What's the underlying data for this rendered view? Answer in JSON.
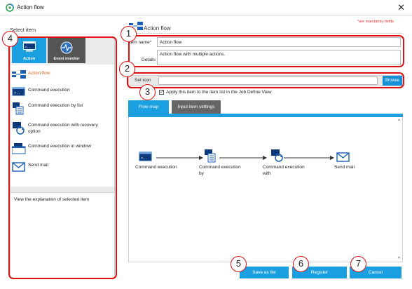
{
  "window": {
    "title": "Action flow",
    "close_glyph": "✕"
  },
  "left": {
    "heading": "Select item",
    "tabs": [
      {
        "label": "Action",
        "icon": "action-icon",
        "color": "#1aa0e0"
      },
      {
        "label": "Event monitor",
        "icon": "event-monitor-icon",
        "color": "#555555"
      }
    ],
    "items": [
      {
        "label": "Action flow",
        "icon": "action-flow-icon",
        "selected": true
      },
      {
        "label": "Command execution",
        "icon": "command-execution-icon"
      },
      {
        "label": "Command execution by list",
        "icon": "command-execution-list-icon"
      },
      {
        "label": "Command execution with recovery option",
        "icon": "command-execution-recovery-icon"
      },
      {
        "label": "Command execution in window",
        "icon": "command-execution-window-icon"
      },
      {
        "label": "Send mail",
        "icon": "mail-icon"
      }
    ],
    "explanation": "View the explanation of selected item"
  },
  "right": {
    "title": "Action flow",
    "mandatory_note": "*are mandatory fields",
    "item_name_label": "Item name*",
    "item_name_value": "Action flow",
    "details_label": "Details",
    "details_value": "Action flow with multiple actions.",
    "set_icon_label": "Set icon",
    "set_icon_value": "",
    "browse_label": "Browse",
    "apply_checked": true,
    "apply_label": "Apply this item to the item list in the Job Define View",
    "tabs": [
      {
        "label": "Flow map",
        "active": true
      },
      {
        "label": "Input item settings",
        "active": false
      }
    ],
    "flow_nodes": [
      {
        "label": "Command execution",
        "icon": "command-execution-icon"
      },
      {
        "label": "Command execution by",
        "icon": "command-execution-list-icon"
      },
      {
        "label": "Command execution with",
        "icon": "command-execution-recovery-icon"
      },
      {
        "label": "Send mail",
        "icon": "mail-icon"
      }
    ]
  },
  "buttons": {
    "save": "Save as file",
    "register": "Register",
    "cancel": "Cancel"
  },
  "annotations": [
    "1",
    "2",
    "3",
    "4",
    "5",
    "6",
    "7"
  ],
  "colors": {
    "accent": "#1aa0e0",
    "annotation_red": "#e01010",
    "selected_text": "#e06020",
    "mandatory": "#e03030"
  }
}
